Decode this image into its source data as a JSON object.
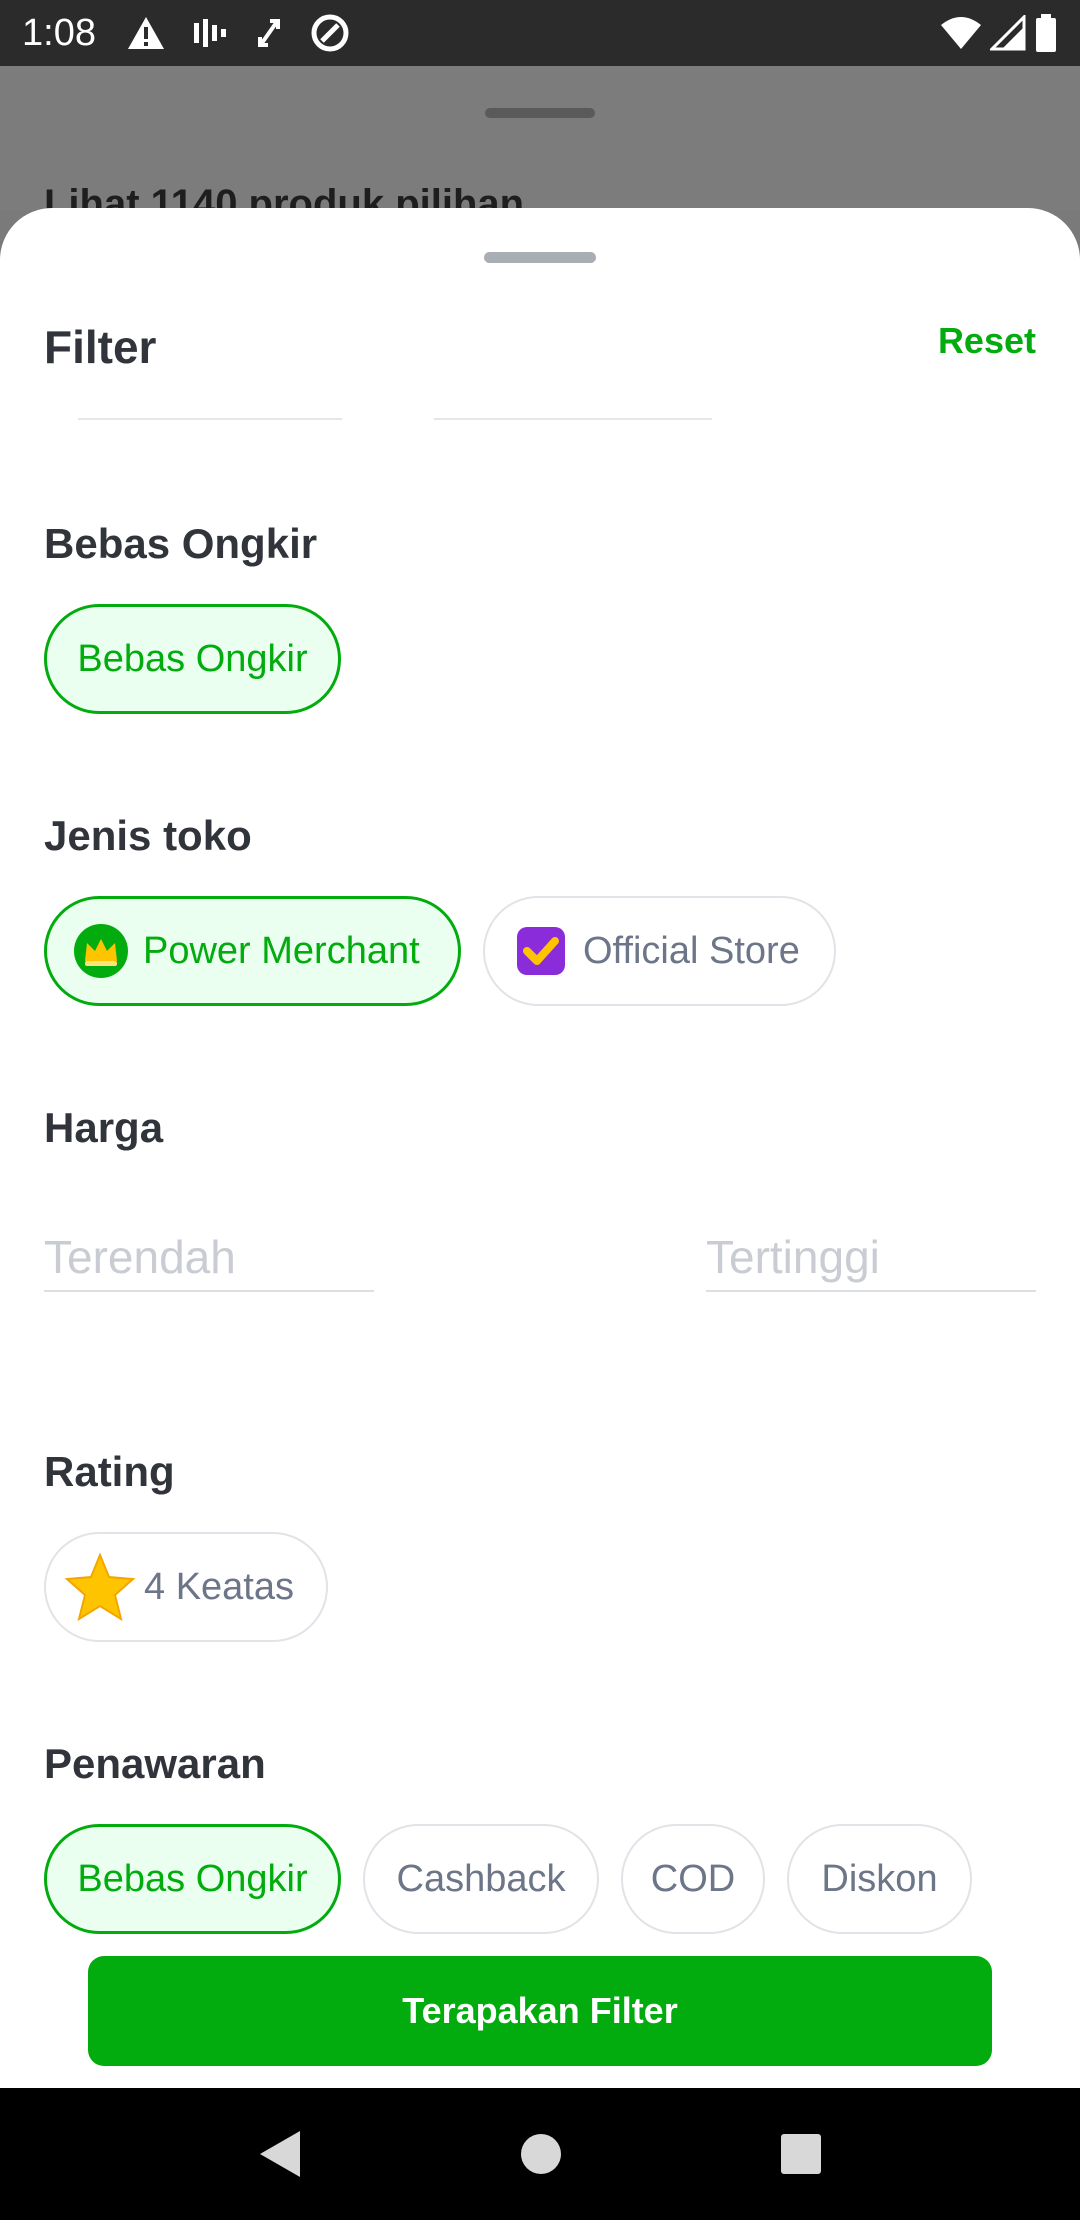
{
  "status_bar": {
    "time": "1:08"
  },
  "backdrop": {
    "title": "Lihat 1140 produk pilihan"
  },
  "sheet": {
    "title": "Filter",
    "reset_label": "Reset"
  },
  "sections": {
    "bebas_ongkir": {
      "title": "Bebas Ongkir",
      "chip_label": "Bebas Ongkir"
    },
    "jenis_toko": {
      "title": "Jenis toko",
      "power_merchant_label": "Power Merchant",
      "official_store_label": "Official Store"
    },
    "harga": {
      "title": "Harga",
      "min_placeholder": "Terendah",
      "max_placeholder": "Tertinggi"
    },
    "rating": {
      "title": "Rating",
      "chip_label": "4 Keatas"
    },
    "penawaran": {
      "title": "Penawaran",
      "chips": [
        "Bebas Ongkir",
        "Cashback",
        "COD",
        "Diskon"
      ]
    }
  },
  "apply_button_label": "Terapakan Filter",
  "colors": {
    "accent": "#03ac0e",
    "chip_selected_bg": "#ebfff0",
    "text_primary": "#31353b",
    "text_secondary": "#6d7588"
  }
}
